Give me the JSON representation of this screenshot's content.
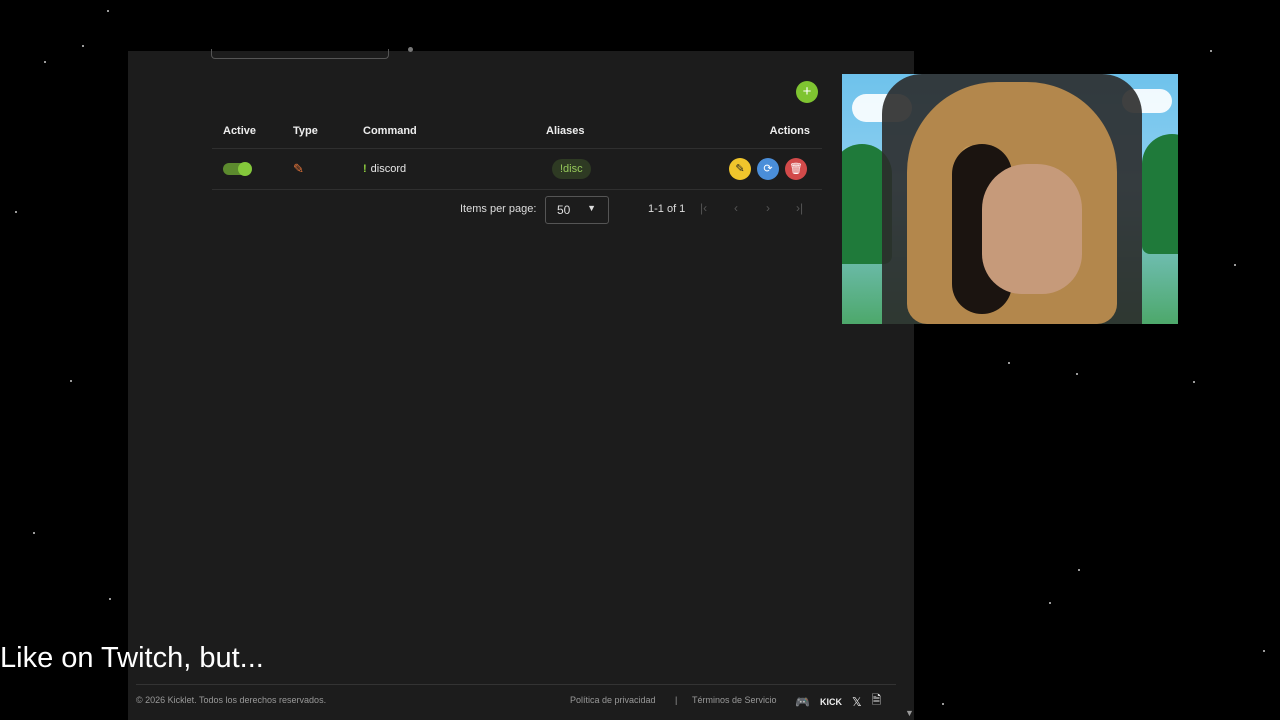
{
  "table": {
    "headers": [
      "Active",
      "Type",
      "Command",
      "Aliases",
      "Actions"
    ],
    "rows": [
      {
        "active": true,
        "type_icon": "pencil-icon",
        "prefix": "!",
        "command": "discord",
        "alias": "!disc"
      }
    ]
  },
  "pagination": {
    "items_per_page_label": "Items per page:",
    "items_per_page": "50",
    "range": "1-1 of 1"
  },
  "footer": {
    "copyright": "© 2026 Kicklet. Todos los derechos reservados.",
    "privacy": "Política de privacidad",
    "separator": "|",
    "terms": "Términos de Servicio",
    "kick": "KICK",
    "x": "𝕏"
  },
  "overlay": {
    "caption": "Like on Twitch, but..."
  },
  "colors": {
    "accent": "#7fc431",
    "edit": "#f0c52c",
    "copy": "#4a8ed9",
    "delete": "#d24a4a"
  }
}
